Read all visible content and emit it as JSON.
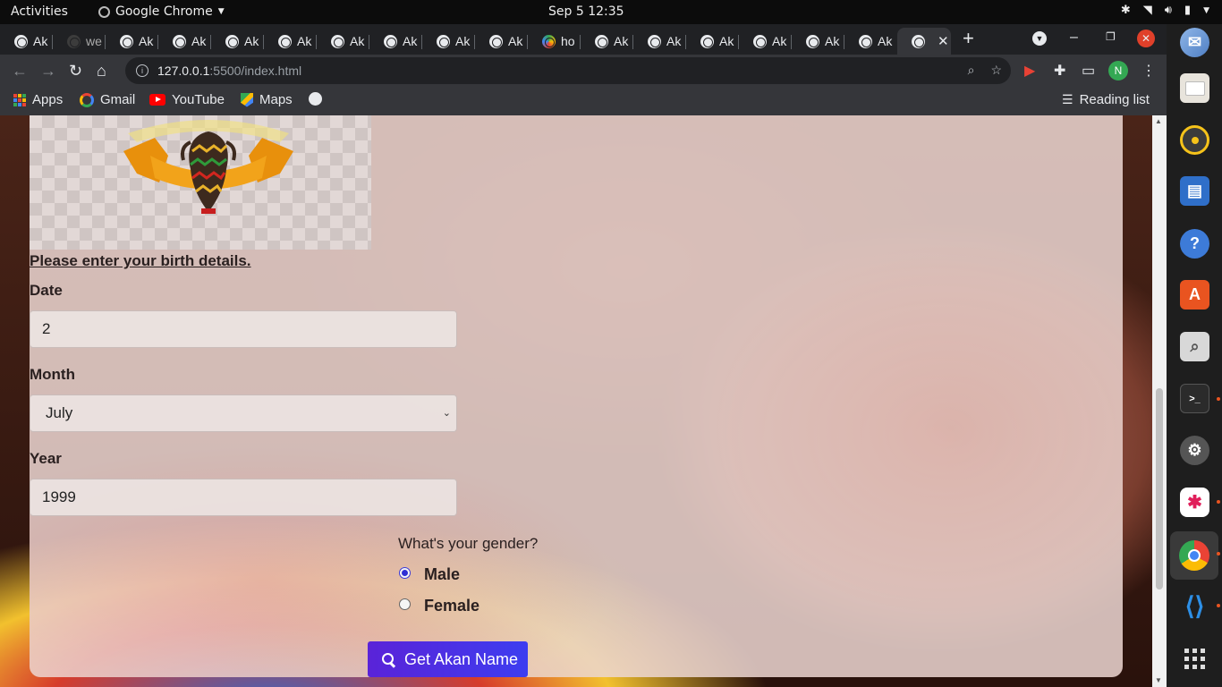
{
  "topbar": {
    "activities": "Activities",
    "app_name": "Google Chrome",
    "clock": "Sep 5  12:35"
  },
  "tabs": [
    "Ak",
    "we",
    "Ak",
    "Ak",
    "Ak",
    "Ak",
    "Ak",
    "Ak",
    "Ak",
    "Ak",
    "ho",
    "Ak",
    "Ak",
    "Ak",
    "Ak",
    "Ak",
    "Ak"
  ],
  "toolbar": {
    "url_host": "127.0.0.1",
    "url_path": ":5500/index.html",
    "avatar_initial": "N"
  },
  "bookmarks": {
    "apps": "Apps",
    "gmail": "Gmail",
    "youtube": "YouTube",
    "maps": "Maps",
    "reading_list": "Reading list"
  },
  "form": {
    "heading": "Please enter your birth details.",
    "date_label": "Date",
    "date_value": "2",
    "month_label": "Month",
    "month_value": "July",
    "year_label": "Year",
    "year_value": "1999",
    "gender_question": "What's your gender?",
    "gender_male": "Male",
    "gender_female": "Female",
    "gender_selected": "Male",
    "submit_label": "Get Akan Name"
  },
  "colors": {
    "button_start": "#5a23d8",
    "button_end": "#3d3df0",
    "radio_selected": "#2f2fd4"
  }
}
